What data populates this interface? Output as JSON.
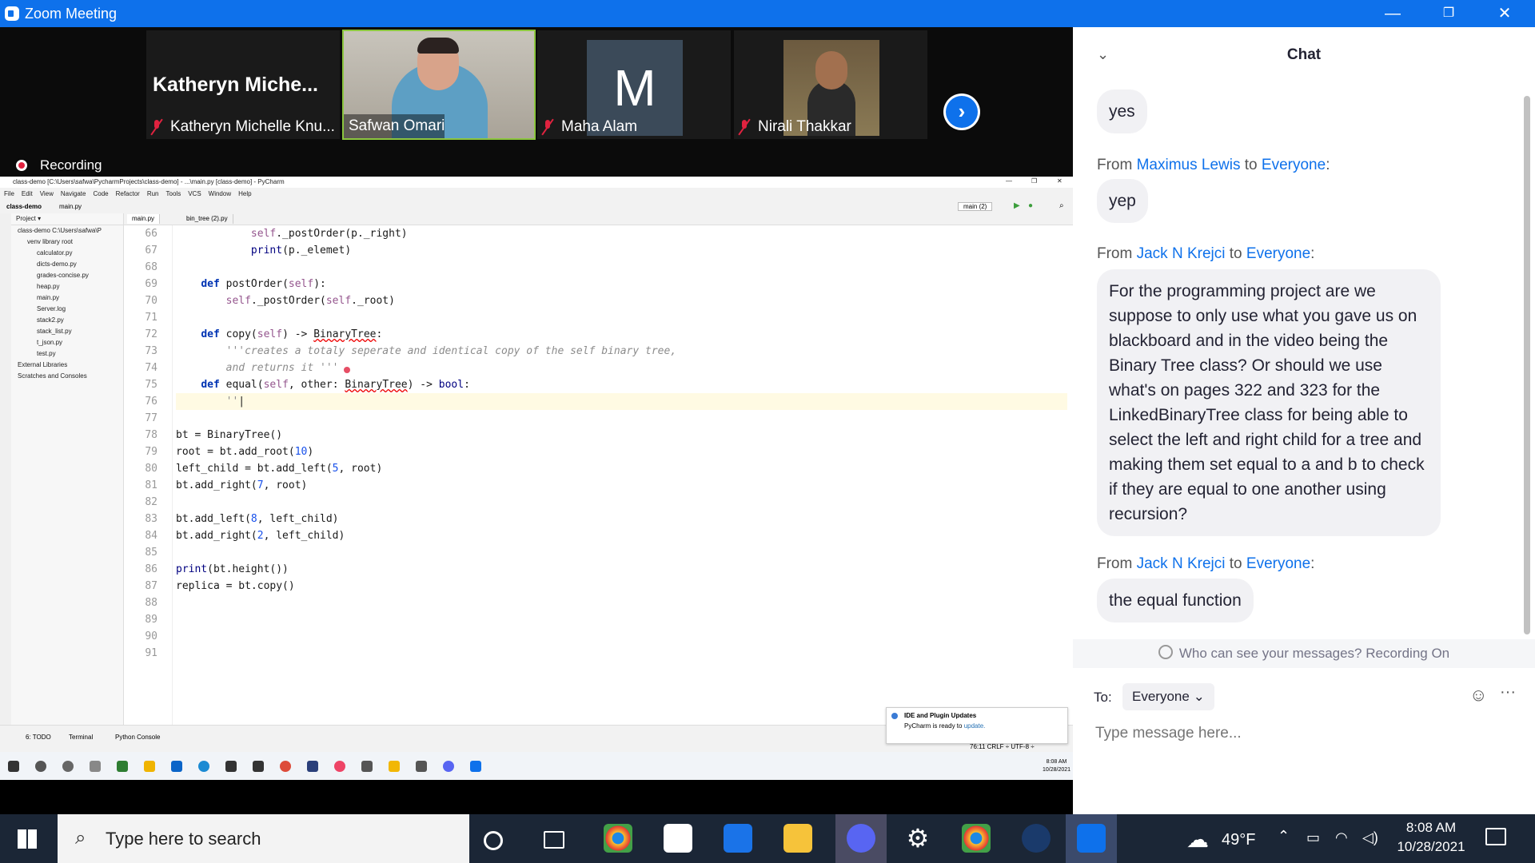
{
  "window": {
    "title": "Zoom Meeting",
    "minimize": "—",
    "restore": "❐",
    "close": "✕"
  },
  "recording": {
    "label": "Recording"
  },
  "participants": [
    {
      "big_name": "Katheryn  Miche...",
      "name": "Katheryn Michelle Knu...",
      "muted": true
    },
    {
      "name": "Safwan Omari",
      "muted": false,
      "active_speaker": true
    },
    {
      "avatar_letter": "M",
      "name": "Maha Alam",
      "muted": true
    },
    {
      "name": "Nirali Thakkar",
      "muted": true
    }
  ],
  "gallery_next": "›",
  "pycharm": {
    "title": "class-demo [C:\\Users\\safwa\\PycharmProjects\\class-demo] - ...\\main.py [class-demo] - PyCharm",
    "menu": [
      "File",
      "Edit",
      "View",
      "Navigate",
      "Code",
      "Refactor",
      "Run",
      "Tools",
      "VCS",
      "Window",
      "Help"
    ],
    "breadcrumb": [
      "class-demo",
      "main.py"
    ],
    "run_config": "main (2)",
    "project_header": "Project",
    "tree": [
      {
        "label": "class-demo  C:\\Users\\safwa\\P",
        "indent": 0
      },
      {
        "label": "venv  library root",
        "indent": 1
      },
      {
        "label": "calculator.py",
        "indent": 2
      },
      {
        "label": "dicts-demo.py",
        "indent": 2
      },
      {
        "label": "grades-concise.py",
        "indent": 2
      },
      {
        "label": "heap.py",
        "indent": 2
      },
      {
        "label": "main.py",
        "indent": 2
      },
      {
        "label": "Server.log",
        "indent": 2
      },
      {
        "label": "stack2.py",
        "indent": 2
      },
      {
        "label": "stack_list.py",
        "indent": 2
      },
      {
        "label": "t_json.py",
        "indent": 2
      },
      {
        "label": "test.py",
        "indent": 2
      },
      {
        "label": "External Libraries",
        "indent": 0
      },
      {
        "label": "Scratches and Consoles",
        "indent": 0
      }
    ],
    "tabs": [
      "main.py",
      "bin_tree (2).py"
    ],
    "line_numbers": [
      "66",
      "67",
      "68",
      "69",
      "70",
      "71",
      "72",
      "73",
      "74",
      "75",
      "76",
      "77",
      "78",
      "79",
      "80",
      "81",
      "82",
      "83",
      "84",
      "85",
      "86",
      "87",
      "88",
      "89",
      "90",
      "91"
    ],
    "bottom_tabs": [
      "6: TODO",
      "Terminal",
      "Python Console"
    ],
    "status": "76:11  CRLF ÷  UTF-8 ÷",
    "notification": {
      "title": "IDE and Plugin Updates",
      "body": "PyCharm is ready to ",
      "link": "update."
    },
    "taskbar_time": "8:08 AM",
    "taskbar_date": "10/28/2021"
  },
  "chat": {
    "title": "Chat",
    "messages": [
      {
        "from": "",
        "to": "",
        "text": "yes"
      },
      {
        "from": "Maximus Lewis",
        "to": "Everyone",
        "text": "yep"
      },
      {
        "from": "Jack N Krejci",
        "to": "Everyone",
        "text": "For the programming project are we suppose to only use what you gave us on blackboard and in the video being the Binary Tree class? Or should we use what's on pages 322 and 323 for the LinkedBinaryTree class for being able to select the left and right child for a tree and making them set equal to a and b to check if they are equal to one another using recursion?"
      },
      {
        "from": "Jack N Krejci",
        "to": "Everyone",
        "text": "the equal function"
      }
    ],
    "from_prefix": "From",
    "to_word": "to",
    "visibility_note": "Who can see your messages? Recording On",
    "to_label": "To:",
    "recipient": "Everyone",
    "input_placeholder": "Type message here..."
  },
  "taskbar": {
    "search_placeholder": "Type here to search",
    "weather": "49°F",
    "time": "8:08 AM",
    "date": "10/28/2021"
  },
  "colors": {
    "zoom_blue": "#0e71eb",
    "muted_red": "#e0223f",
    "taskbar": "#1b2636"
  }
}
